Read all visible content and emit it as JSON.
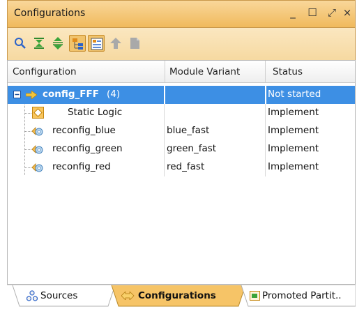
{
  "window": {
    "title": "Configurations",
    "controls": {
      "minimize": "_",
      "maximize": "☐",
      "float": "⤢",
      "close": "×"
    }
  },
  "toolbar": {
    "buttons": [
      {
        "name": "search-icon",
        "active": false
      },
      {
        "name": "collapse-all-icon",
        "active": false
      },
      {
        "name": "expand-all-icon",
        "active": false
      },
      {
        "name": "hierarchy-view-icon",
        "active": true
      },
      {
        "name": "flat-view-icon",
        "active": true
      },
      {
        "name": "promote-icon",
        "active": false
      },
      {
        "name": "document-icon",
        "active": false
      }
    ]
  },
  "table": {
    "columns": [
      "Configuration",
      "Module Variant",
      "Status"
    ],
    "rows": [
      {
        "name": "config_FFF",
        "count": "(4)",
        "variant": "",
        "status": "Not started",
        "selected": true,
        "icon": "arrow-right-icon"
      },
      {
        "name": "Static Logic",
        "variant": "",
        "status": "Implement",
        "icon": "static-logic-icon"
      },
      {
        "name": "reconfig_blue",
        "variant": "blue_fast",
        "status": "Implement",
        "icon": "reconfig-module-icon"
      },
      {
        "name": "reconfig_green",
        "variant": "green_fast",
        "status": "Implement",
        "icon": "reconfig-module-icon"
      },
      {
        "name": "reconfig_red",
        "variant": "red_fast",
        "status": "Implement",
        "icon": "reconfig-module-icon"
      }
    ]
  },
  "tabs": [
    {
      "label": "Sources",
      "active": false,
      "icon": "sources-icon"
    },
    {
      "label": "Configurations",
      "active": true,
      "icon": "configurations-icon"
    },
    {
      "label": "Promoted Partit..",
      "active": false,
      "icon": "promoted-partitions-icon"
    }
  ],
  "colors": {
    "titlebar": "#f0b95c",
    "selection": "#3d8fe4",
    "active_tab": "#f6c467"
  }
}
